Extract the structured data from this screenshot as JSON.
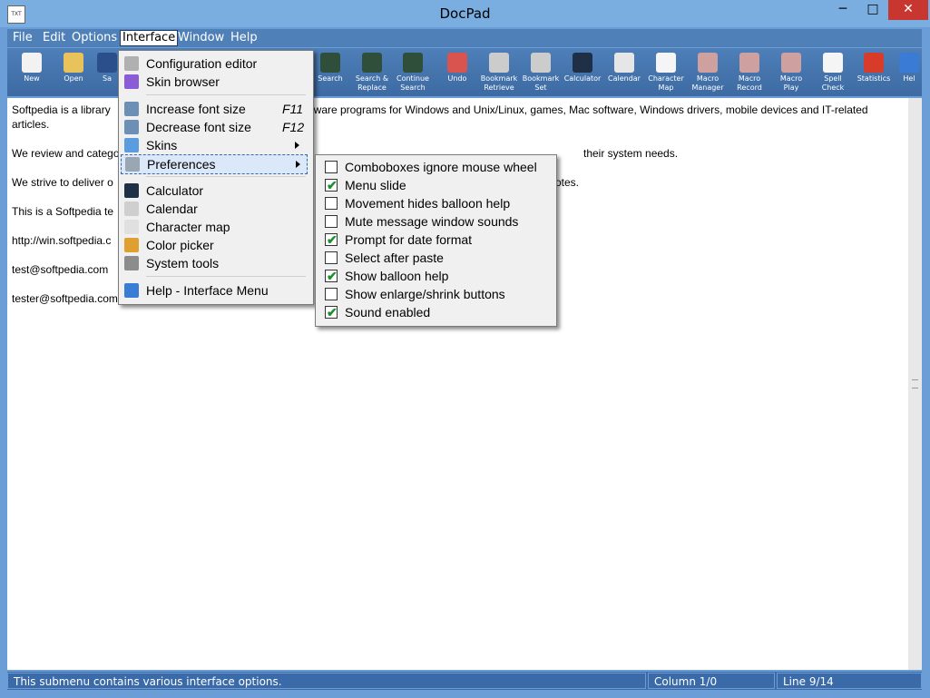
{
  "window": {
    "title": "DocPad",
    "icon_label": "TXT",
    "minimize": "─",
    "maximize": "□",
    "close": "✕"
  },
  "menubar": [
    "File",
    "Edit",
    "Options",
    "Interface",
    "Window",
    "Help"
  ],
  "toolbar": [
    {
      "label1": "New",
      "label2": "",
      "icon": "new-file-icon",
      "color": "#f2f2f2"
    },
    {
      "label1": "Open",
      "label2": "",
      "icon": "open-folder-icon",
      "color": "#e8c25a"
    },
    {
      "label1": "Sa",
      "label2": "",
      "icon": "save-icon",
      "color": "#2a4f8a"
    },
    {
      "label1": "Search",
      "label2": "",
      "icon": "binoculars-icon",
      "color": "#2f4f3a"
    },
    {
      "label1": "Search &",
      "label2": "Replace",
      "icon": "binoculars-replace-icon",
      "color": "#2f4f3a"
    },
    {
      "label1": "Continue",
      "label2": "Search",
      "icon": "binoculars-continue-icon",
      "color": "#2f4f3a"
    },
    {
      "label1": "Undo",
      "label2": "",
      "icon": "eraser-icon",
      "color": "#d9534f"
    },
    {
      "label1": "Bookmark",
      "label2": "Retrieve",
      "icon": "bookmark-retrieve-icon",
      "color": "#cccccc"
    },
    {
      "label1": "Bookmark",
      "label2": "Set",
      "icon": "bookmark-set-icon",
      "color": "#cccccc"
    },
    {
      "label1": "Calculator",
      "label2": "",
      "icon": "calculator-icon",
      "color": "#1f2f45"
    },
    {
      "label1": "Calendar",
      "label2": "",
      "icon": "calendar-icon",
      "color": "#e6e6e6"
    },
    {
      "label1": "Character",
      "label2": "Map",
      "icon": "character-map-icon",
      "color": "#f5f5f5"
    },
    {
      "label1": "Macro",
      "label2": "Manager",
      "icon": "macro-manager-icon",
      "color": "#cfa0a0"
    },
    {
      "label1": "Macro",
      "label2": "Record",
      "icon": "macro-record-icon",
      "color": "#cfa0a0"
    },
    {
      "label1": "Macro",
      "label2": "Play",
      "icon": "macro-play-icon",
      "color": "#cfa0a0"
    },
    {
      "label1": "Spell",
      "label2": "Check",
      "icon": "spell-check-icon",
      "color": "#f5f5f5"
    },
    {
      "label1": "Statistics",
      "label2": "",
      "icon": "pie-chart-icon",
      "color": "#d93b2b"
    },
    {
      "label1": "Hel",
      "label2": "",
      "icon": "help-icon",
      "color": "#3a7bd5"
    }
  ],
  "document": {
    "lines": [
      "Softpedia is a library",
      "articles.",
      "We review and catego",
      "We strive to deliver o",
      "This is a Softpedia te",
      "http://win.softpedia.c",
      "test@softpedia.com",
      "tester@softpedia.com"
    ],
    "line0_tail": "ftware programs for Windows and Unix/Linux, games, Mac software, Windows drivers, mobile devices and IT-related",
    "line2_tail": "their system needs.",
    "line3_tail": "otes."
  },
  "interface_menu": {
    "items": [
      {
        "label": "Configuration editor",
        "shortcut": "",
        "icon": "configuration-icon",
        "color": "#b0b0b0"
      },
      {
        "label": "Skin browser",
        "shortcut": "",
        "icon": "skin-browser-icon",
        "color": "#8a5cd6"
      },
      {
        "label": "Increase font size",
        "shortcut": "F11",
        "icon": "zoom-in-icon",
        "color": "#6e8fb5"
      },
      {
        "label": "Decrease font size",
        "shortcut": "F12",
        "icon": "zoom-out-icon",
        "color": "#6e8fb5"
      },
      {
        "label": "Skins",
        "shortcut": "",
        "icon": "skins-icon",
        "color": "#5b9be0"
      },
      {
        "label": "Preferences",
        "shortcut": "",
        "icon": "gear-icon",
        "color": "#9aa6b2"
      },
      {
        "label": "Calculator",
        "shortcut": "",
        "icon": "calculator-icon",
        "color": "#1f2f45"
      },
      {
        "label": "Calendar",
        "shortcut": "",
        "icon": "calendar-icon",
        "color": "#cfcfcf"
      },
      {
        "label": "Character map",
        "shortcut": "",
        "icon": "character-map-icon",
        "color": "#e0e0e0"
      },
      {
        "label": "Color picker",
        "shortcut": "",
        "icon": "color-picker-icon",
        "color": "#e0a030"
      },
      {
        "label": "System tools",
        "shortcut": "",
        "icon": "tools-icon",
        "color": "#8c8c8c"
      },
      {
        "label": "Help - Interface Menu",
        "shortcut": "",
        "icon": "help-icon",
        "color": "#3a7bd5"
      }
    ]
  },
  "preferences_menu": {
    "items": [
      {
        "label": "Comboboxes ignore mouse wheel",
        "checked": false
      },
      {
        "label": "Menu slide",
        "checked": true
      },
      {
        "label": "Movement hides balloon help",
        "checked": false
      },
      {
        "label": "Mute message window sounds",
        "checked": false
      },
      {
        "label": "Prompt for date format",
        "checked": true
      },
      {
        "label": "Select after paste",
        "checked": false
      },
      {
        "label": "Show balloon help",
        "checked": true
      },
      {
        "label": "Show enlarge/shrink buttons",
        "checked": false
      },
      {
        "label": "Sound enabled",
        "checked": true
      }
    ],
    "checkmark": "✔"
  },
  "statusbar": {
    "message": "This submenu contains various interface options.",
    "column": "Column 1/0",
    "line": "Line 9/14"
  }
}
